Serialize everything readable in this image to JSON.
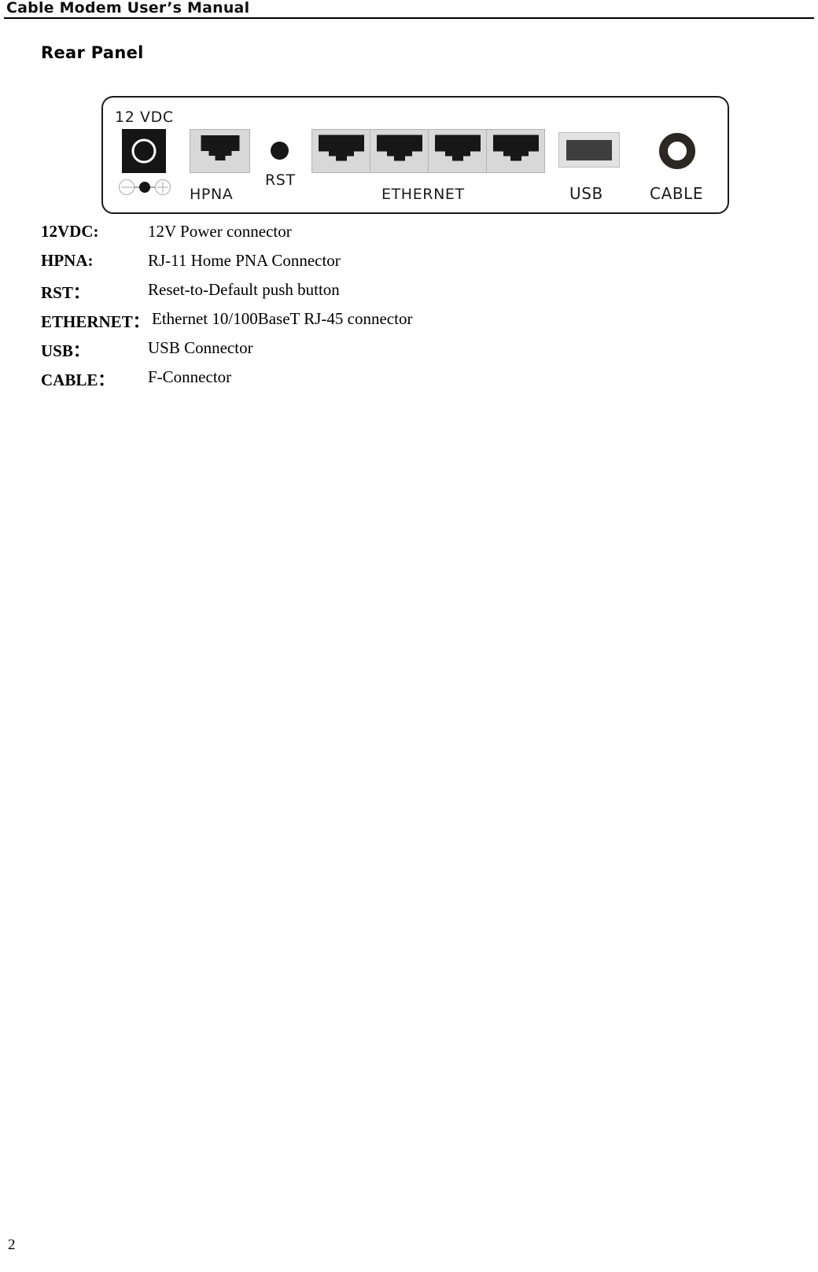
{
  "header": {
    "title": "Cable Modem User’s Manual"
  },
  "section": {
    "heading": "Rear Panel"
  },
  "figure": {
    "name": "rear-panel-diagram",
    "labels": {
      "dc": "12 VDC",
      "hpna": "HPNA",
      "rst": "RST",
      "ethernet": "ETHERNET",
      "usb": "USB",
      "cable": "CABLE"
    },
    "ethernet_port_count": 4,
    "colors": {
      "panel_outline": "#1a1a1a",
      "port_plastic": "#d8d8d8",
      "port_border": "#b4b4b4",
      "jack_black": "#151515",
      "usb_slot": "#3e3e3e",
      "cable_ring": "#2b2723"
    }
  },
  "definitions": [
    {
      "term": "12VDC:",
      "desc": "12V Power connector"
    },
    {
      "term": "HPNA:",
      "desc": "RJ-11 Home PNA Connector"
    },
    {
      "term": "RST：",
      "desc": "Reset-to-Default push button"
    },
    {
      "term": "ETHERNET：",
      "desc": "Ethernet 10/100BaseT RJ-45 connector"
    },
    {
      "term": "USB：",
      "desc": "USB Connector"
    },
    {
      "term": "CABLE：",
      "desc": "F-Connector"
    }
  ],
  "footer": {
    "page_number": "2"
  }
}
